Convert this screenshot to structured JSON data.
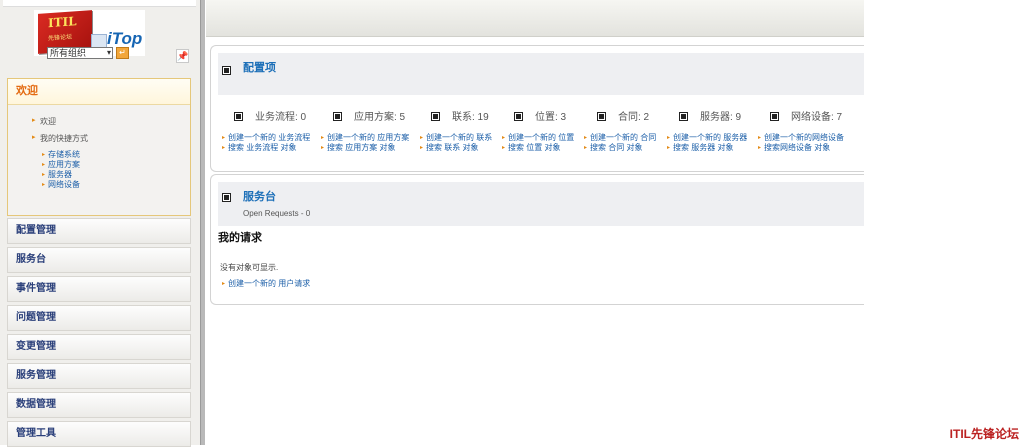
{
  "logo": {
    "flag_text": "ITIL",
    "flag_subtext": "先锋论坛",
    "brand_text": "iTop"
  },
  "org_selector": {
    "value": "所有组织"
  },
  "welcome_panel": {
    "title": "欢迎",
    "items": [
      "欢迎",
      "我的快捷方式"
    ],
    "shortcuts": [
      "存储系统",
      "应用方案",
      "服务器",
      "网络设备"
    ]
  },
  "menu": [
    "配置管理",
    "服务台",
    "事件管理",
    "问题管理",
    "变更管理",
    "服务管理",
    "数据管理",
    "管理工具"
  ],
  "config_panel": {
    "title": "配置项",
    "stats": [
      {
        "label": "业务流程: 0"
      },
      {
        "label": "应用方案: 5"
      },
      {
        "label": "联系: 19"
      },
      {
        "label": "位置: 3"
      },
      {
        "label": "合同: 2"
      },
      {
        "label": "服务器: 9"
      },
      {
        "label": "网络设备: 7"
      }
    ],
    "actions": [
      {
        "create": "创建一个新的 业务流程",
        "search": "搜索 业务流程 对象"
      },
      {
        "create": "创建一个新的 应用方案",
        "search": "搜索 应用方案 对象"
      },
      {
        "create": "创建一个新的 联系",
        "search": "搜索 联系 对象"
      },
      {
        "create": "创建一个新的 位置",
        "search": "搜索 位置 对象"
      },
      {
        "create": "创建一个新的 合同",
        "search": "搜索 合同 对象"
      },
      {
        "create": "创建一个新的 服务器",
        "search": "搜索 服务器 对象"
      },
      {
        "create": "创建一个新的网络设备",
        "search": "搜索网络设备 对象"
      }
    ]
  },
  "service_panel": {
    "title": "服务台",
    "subtitle": "Open Requests - 0",
    "my_requests": "我的请求",
    "empty_text": "没有对象可显示.",
    "create_link": "创建一个新的 用户请求"
  },
  "footer": {
    "brand": "ITIL先锋论坛"
  }
}
